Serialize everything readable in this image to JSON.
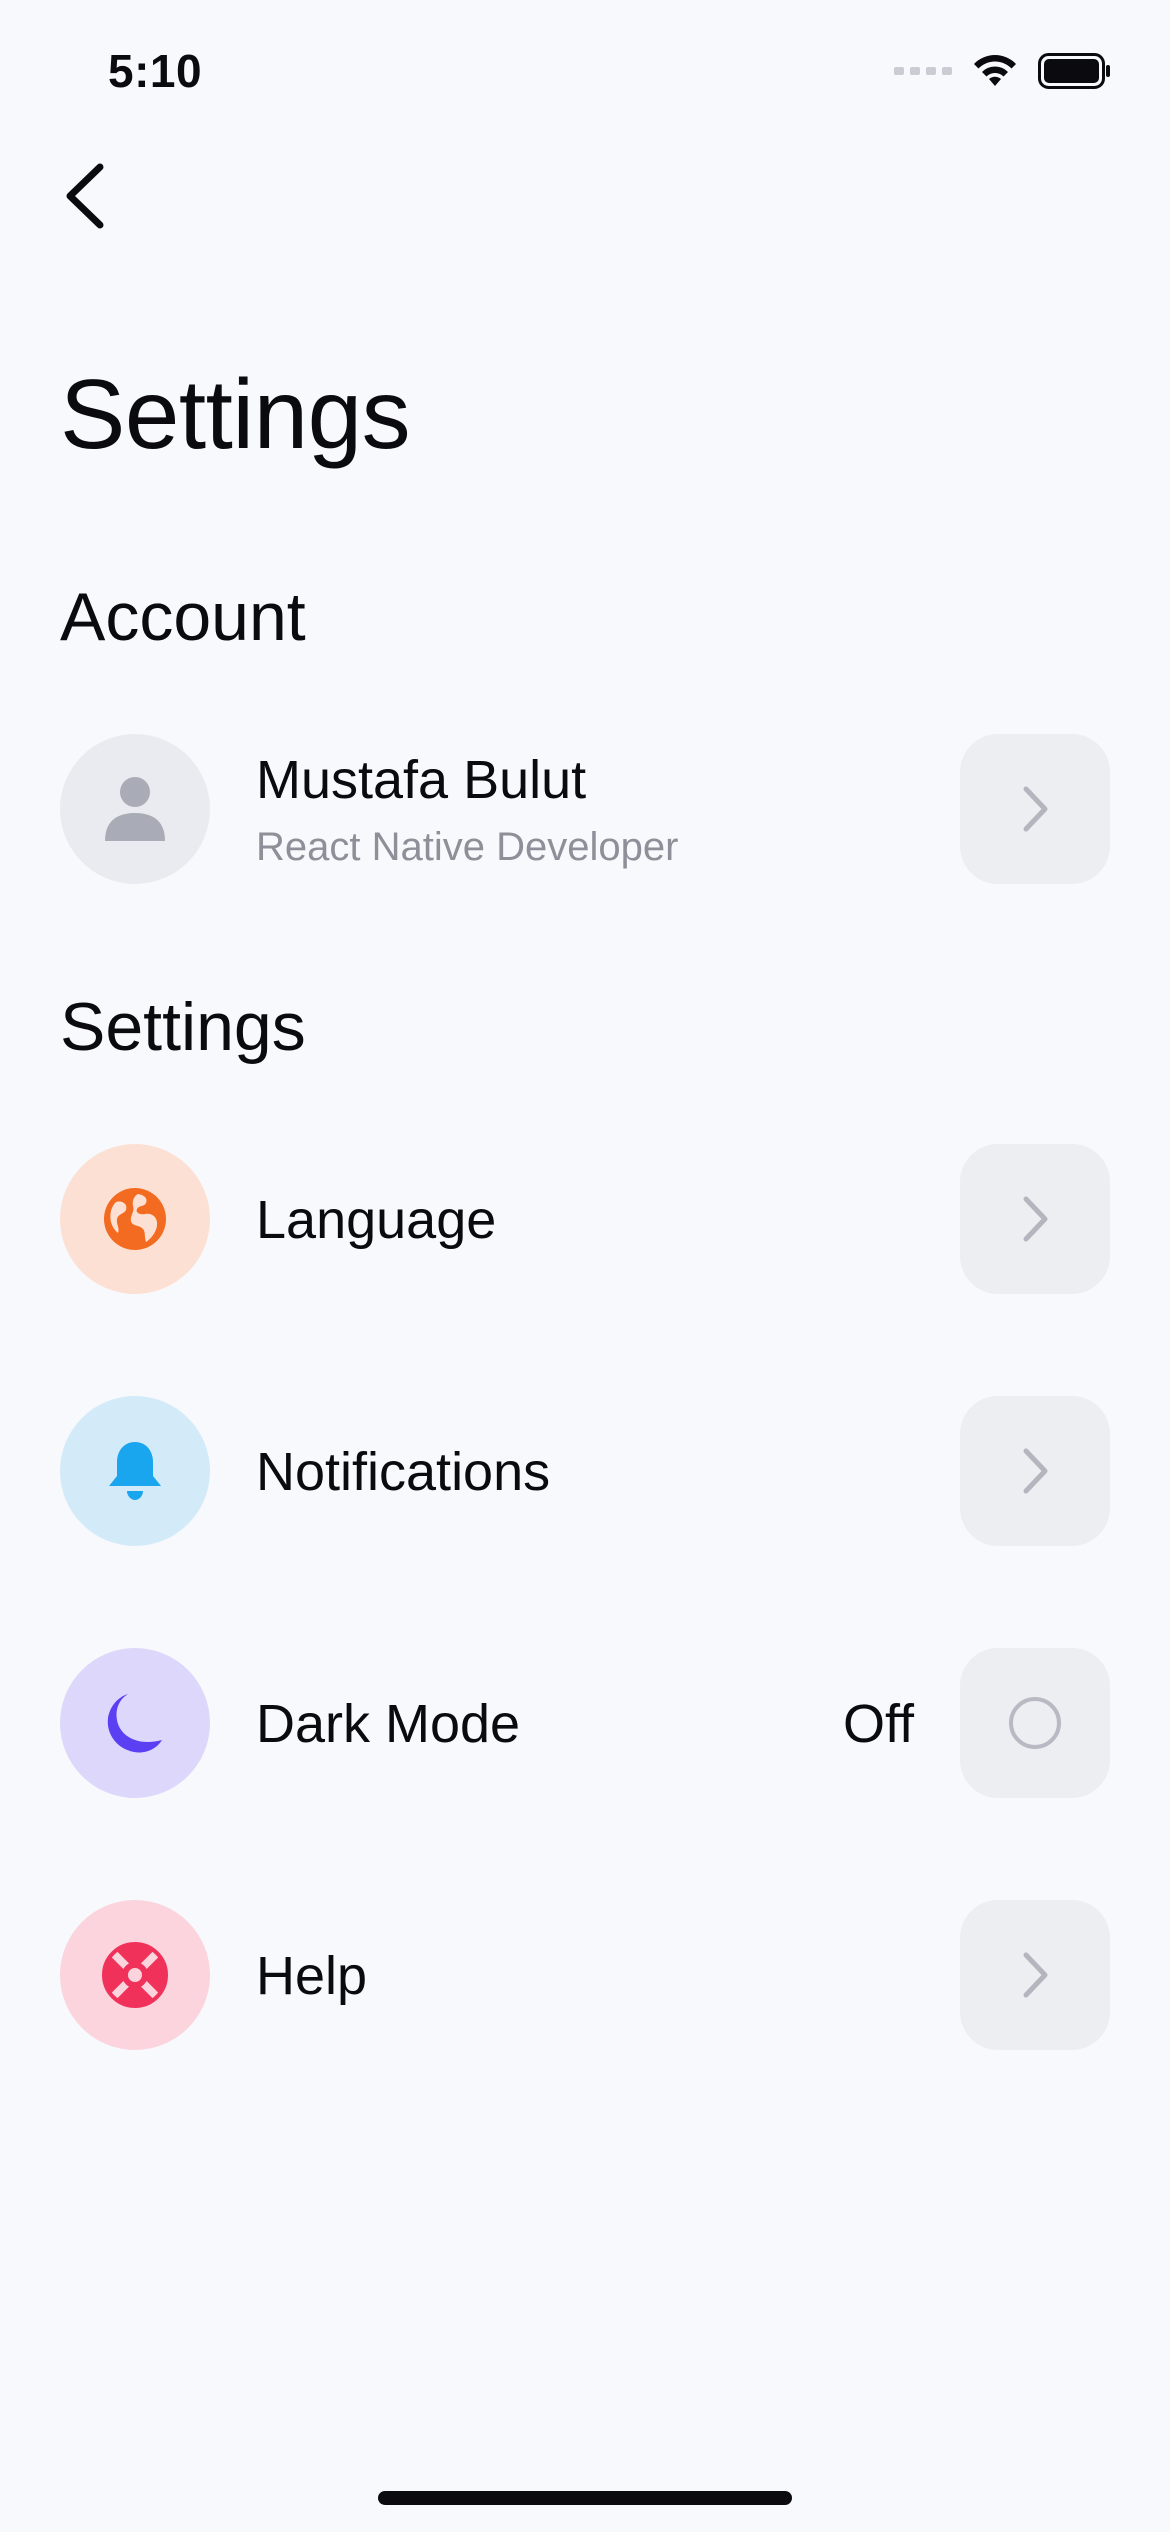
{
  "status_bar": {
    "time": "5:10"
  },
  "header": {
    "title": "Settings"
  },
  "account": {
    "section_title": "Account",
    "profile": {
      "name": "Mustafa Bulut",
      "role": "React Native Developer",
      "avatar_icon": "person-icon"
    }
  },
  "settings": {
    "section_title": "Settings",
    "items": [
      {
        "label": "Language",
        "icon": "globe-icon",
        "icon_color": "#f26b21",
        "bg_color": "#fde0d4"
      },
      {
        "label": "Notifications",
        "icon": "bell-icon",
        "icon_color": "#19a6ee",
        "bg_color": "#d3eaf8"
      },
      {
        "label": "Dark Mode",
        "icon": "moon-icon",
        "icon_color": "#5b3ff2",
        "bg_color": "#ddd7fc",
        "value": "Off",
        "toggle_on": false
      },
      {
        "label": "Help",
        "icon": "lifebuoy-icon",
        "icon_color": "#f0315a",
        "bg_color": "#fbd4dd"
      }
    ]
  },
  "colors": {
    "background": "#f7f9fc",
    "button_bg": "#eceef2",
    "chevron": "#b3b6be",
    "secondary_text": "#8e9099"
  }
}
